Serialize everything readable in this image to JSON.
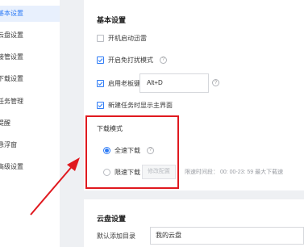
{
  "sidebar": {
    "items": [
      {
        "label": "基本设置",
        "active": true
      },
      {
        "label": "云盘设置",
        "active": false
      },
      {
        "label": "接管设置",
        "active": false
      },
      {
        "label": "下载设置",
        "active": false
      },
      {
        "label": "任务管理",
        "active": false
      },
      {
        "label": "提醒",
        "active": false
      },
      {
        "label": "悬浮窗",
        "active": false
      },
      {
        "label": "高级设置",
        "active": false
      }
    ]
  },
  "basic": {
    "title": "基本设置",
    "autostart": {
      "label": "开机启动迅雷",
      "checked": false
    },
    "dnd": {
      "label": "开启免打扰模式",
      "checked": true
    },
    "boss_key": {
      "label": "启用老板键",
      "checked": true,
      "hotkey": "Alt+D"
    },
    "new_task_main": {
      "label": "新建任务时显示主界面",
      "checked": true
    }
  },
  "download_mode": {
    "title": "下载模式",
    "full_speed": {
      "label": "全速下载",
      "selected": true
    },
    "limited": {
      "label": "限速下载",
      "selected": false,
      "button": "修改配置"
    },
    "limit_info": "限速时间段：  00: 00-23: 59  最大下载速"
  },
  "cloud": {
    "title": "云盘设置",
    "default_dir_label": "默认添加目录",
    "default_dir_value": "我的云盘"
  },
  "colors": {
    "accent": "#2f7cf6",
    "highlight": "#e0191f"
  }
}
